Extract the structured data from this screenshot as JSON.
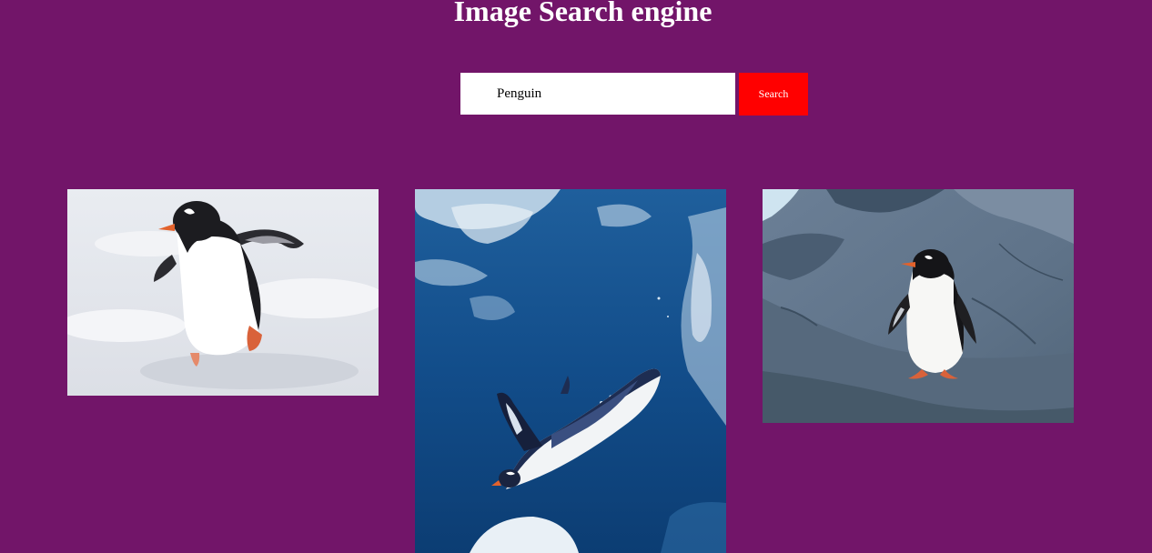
{
  "header": {
    "title": "Image Search engine"
  },
  "search": {
    "value": "Penguin",
    "button_label": "Search"
  },
  "results": [
    {
      "subject": "penguin walking on snow"
    },
    {
      "subject": "penguin swimming underwater"
    },
    {
      "subject": "penguin standing on rock"
    }
  ],
  "colors": {
    "background": "#721569",
    "button": "#ff0000",
    "title": "#ffffff"
  }
}
